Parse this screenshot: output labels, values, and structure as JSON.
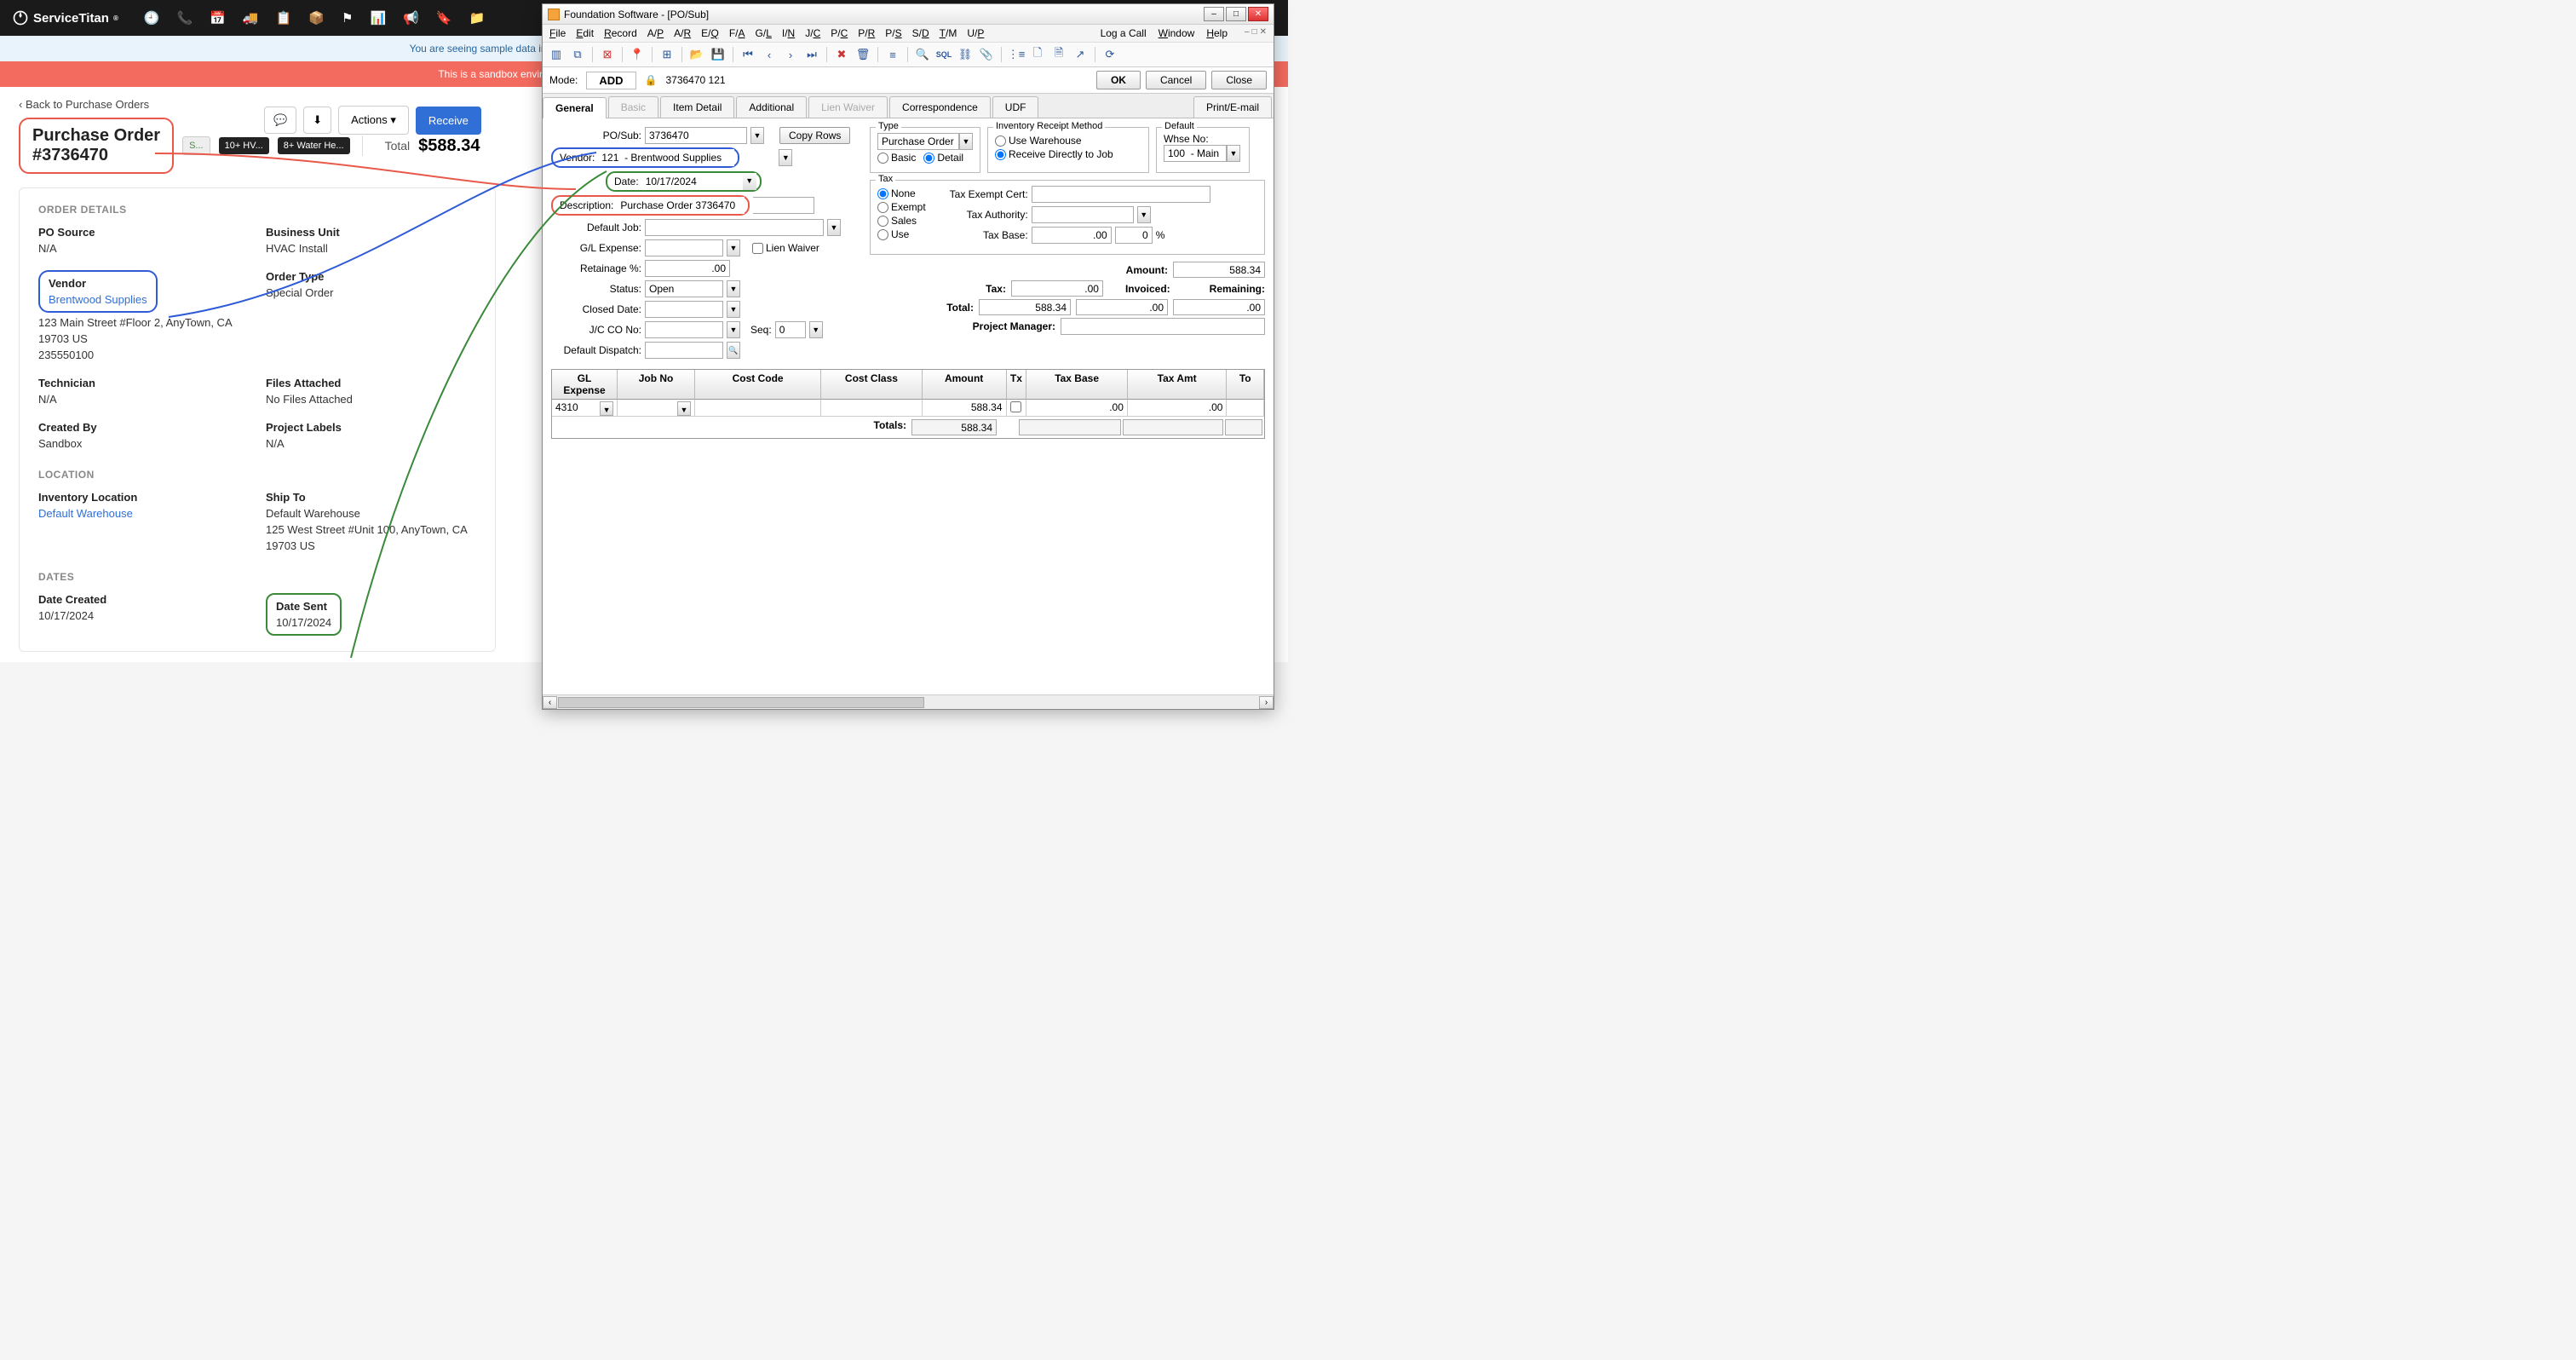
{
  "st": {
    "brand": "ServiceTitan",
    "banner_blue": "You are seeing sample data in your account. When you're ready to get started, click here to reset your a",
    "banner_red": "This is a sandbox environment, not your live account. Changes made here will not affect yo",
    "back": "Back to Purchase Orders",
    "title_l1": "Purchase Order",
    "title_l2": "#3736470",
    "chips": {
      "status": "S...",
      "tag1": "10+ HV...",
      "tag2": "8+ Water He..."
    },
    "total_lbl": "Total",
    "total_val": "$588.34",
    "actions": "Actions",
    "receive": "Receive",
    "sects": {
      "order": "ORDER DETAILS",
      "location": "LOCATION",
      "dates": "DATES"
    },
    "fields": {
      "po_src": {
        "l": "PO Source",
        "v": "N/A"
      },
      "bu": {
        "l": "Business Unit",
        "v": "HVAC Install"
      },
      "vendor": {
        "l": "Vendor",
        "v": "Brentwood Supplies",
        "addr1": "123 Main Street #Floor 2, AnyTown, CA",
        "addr2": "19703 US",
        "addr3": "235550100"
      },
      "otype": {
        "l": "Order Type",
        "v": "Special Order"
      },
      "tech": {
        "l": "Technician",
        "v": "N/A"
      },
      "files": {
        "l": "Files Attached",
        "v": "No Files Attached"
      },
      "cby": {
        "l": "Created By",
        "v": "Sandbox"
      },
      "plabels": {
        "l": "Project Labels",
        "v": "N/A"
      },
      "invloc": {
        "l": "Inventory Location",
        "v": "Default Warehouse"
      },
      "ship": {
        "l": "Ship To",
        "v1": "Default Warehouse",
        "v2": "125 West Street #Unit 100, AnyTown, CA",
        "v3": "19703 US"
      },
      "dcreated": {
        "l": "Date Created",
        "v": "10/17/2024"
      },
      "dsent": {
        "l": "Date Sent",
        "v": "10/17/2024"
      }
    }
  },
  "fnd": {
    "title": "Foundation Software - [PO/Sub]",
    "menu": [
      "File",
      "Edit",
      "Record",
      "A/P",
      "A/R",
      "E/Q",
      "F/A",
      "G/L",
      "I/N",
      "J/C",
      "P/C",
      "P/R",
      "P/S",
      "S/D",
      "T/M",
      "U/P"
    ],
    "menu_right": [
      "Log a Call",
      "Window",
      "Help"
    ],
    "mode_lbl": "Mode:",
    "mode_val": "ADD",
    "mode_ids": "3736470  121",
    "ok": "OK",
    "cancel": "Cancel",
    "close": "Close",
    "tabs": {
      "general": "General",
      "basic": "Basic",
      "item": "Item Detail",
      "addl": "Additional",
      "lien": "Lien Waiver",
      "corr": "Correspondence",
      "udf": "UDF",
      "print": "Print/E-mail"
    },
    "form": {
      "posub_l": "PO/Sub:",
      "posub_v": "3736470",
      "copy": "Copy Rows",
      "vendor_l": "Vendor:",
      "vendor_v": "121  - Brentwood Supplies",
      "date_l": "Date:",
      "date_v": "10/17/2024",
      "desc_l": "Description:",
      "desc_v": "Purchase Order 3736470",
      "djob_l": "Default Job:",
      "djob_v": "",
      "gle_l": "G/L Expense:",
      "gle_v": "",
      "lien_cb": "Lien Waiver",
      "ret_l": "Retainage %:",
      "ret_v": ".00",
      "status_l": "Status:",
      "status_v": "Open",
      "closed_l": "Closed Date:",
      "closed_v": "",
      "jcco_l": "J/C CO No:",
      "jcco_v": "",
      "seq_l": "Seq:",
      "seq_v": "0",
      "disp_l": "Default Dispatch:",
      "disp_v": ""
    },
    "type_box": {
      "legend": "Type",
      "sel": "Purchase Order",
      "basic": "Basic",
      "detail": "Detail"
    },
    "inv_box": {
      "legend": "Inventory Receipt Method",
      "ware": "Use Warehouse",
      "job": "Receive Directly to Job"
    },
    "def_box": {
      "legend": "Default",
      "whse_l": "Whse No:",
      "whse_v": "100  - Main"
    },
    "tax_box": {
      "legend": "Tax",
      "none": "None",
      "exempt": "Exempt",
      "sales": "Sales",
      "use": "Use",
      "cert_l": "Tax Exempt Cert:",
      "auth_l": "Tax Authority:",
      "base_l": "Tax Base:",
      "base_v": ".00",
      "pct_v": "0",
      "pct_s": "%"
    },
    "amts": {
      "amount_l": "Amount:",
      "amount_v": "588.34",
      "tax_l": "Tax:",
      "tax_v": ".00",
      "total_l": "Total:",
      "total_v": "588.34",
      "inv_l": "Invoiced:",
      "inv_v": ".00",
      "rem_l": "Remaining:",
      "rem_v": ".00",
      "pm_l": "Project Manager:"
    },
    "grid": {
      "hdr": {
        "gl": "GL Expense",
        "job": "Job No",
        "cost": "Cost Code",
        "class": "Cost Class",
        "amt": "Amount",
        "tx": "Tx",
        "tbase": "Tax Base",
        "tamt": "Tax Amt",
        "tot": "To"
      },
      "row": {
        "gl": "4310",
        "amt": "588.34",
        "tbase": ".00",
        "tamt": ".00"
      },
      "totals_l": "Totals:",
      "totals_amt": "588.34"
    }
  }
}
